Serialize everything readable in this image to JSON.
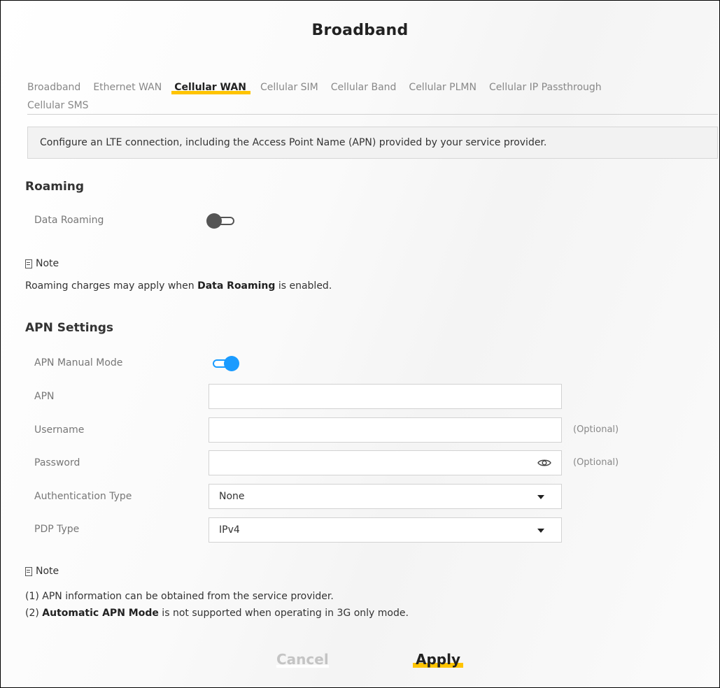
{
  "page": {
    "title": "Broadband"
  },
  "tabs": {
    "row1": [
      "Broadband",
      "Ethernet WAN",
      "Cellular WAN",
      "Cellular SIM",
      "Cellular Band",
      "Cellular PLMN",
      "Cellular IP Passthrough"
    ],
    "row2": [
      "Cellular SMS"
    ],
    "active": "Cellular WAN"
  },
  "info": "Configure an LTE connection, including the Access Point Name (APN) provided by your service provider.",
  "roaming": {
    "title": "Roaming",
    "data_roaming_label": "Data Roaming",
    "data_roaming_enabled": false,
    "note_label": "Note",
    "note_pre": "Roaming charges may apply when ",
    "note_bold": "Data Roaming",
    "note_post": " is enabled."
  },
  "apn": {
    "title": "APN Settings",
    "manual_mode_label": "APN Manual Mode",
    "manual_mode_enabled": true,
    "apn_label": "APN",
    "apn_value": "",
    "username_label": "Username",
    "username_value": "",
    "username_hint": "(Optional)",
    "password_label": "Password",
    "password_value": "",
    "password_hint": "(Optional)",
    "auth_label": "Authentication Type",
    "auth_value": "None",
    "pdp_label": "PDP Type",
    "pdp_value": "IPv4"
  },
  "note2": {
    "label": "Note",
    "line1": "(1) APN information can be obtained from the service provider.",
    "line2_pre": "(2) ",
    "line2_bold": "Automatic APN Mode",
    "line2_post": " is not supported when operating in 3G only mode."
  },
  "buttons": {
    "cancel": "Cancel",
    "apply": "Apply"
  },
  "colors": {
    "accent": "#ffc400",
    "toggle_on": "#1a9bff",
    "toggle_off": "#555555"
  }
}
